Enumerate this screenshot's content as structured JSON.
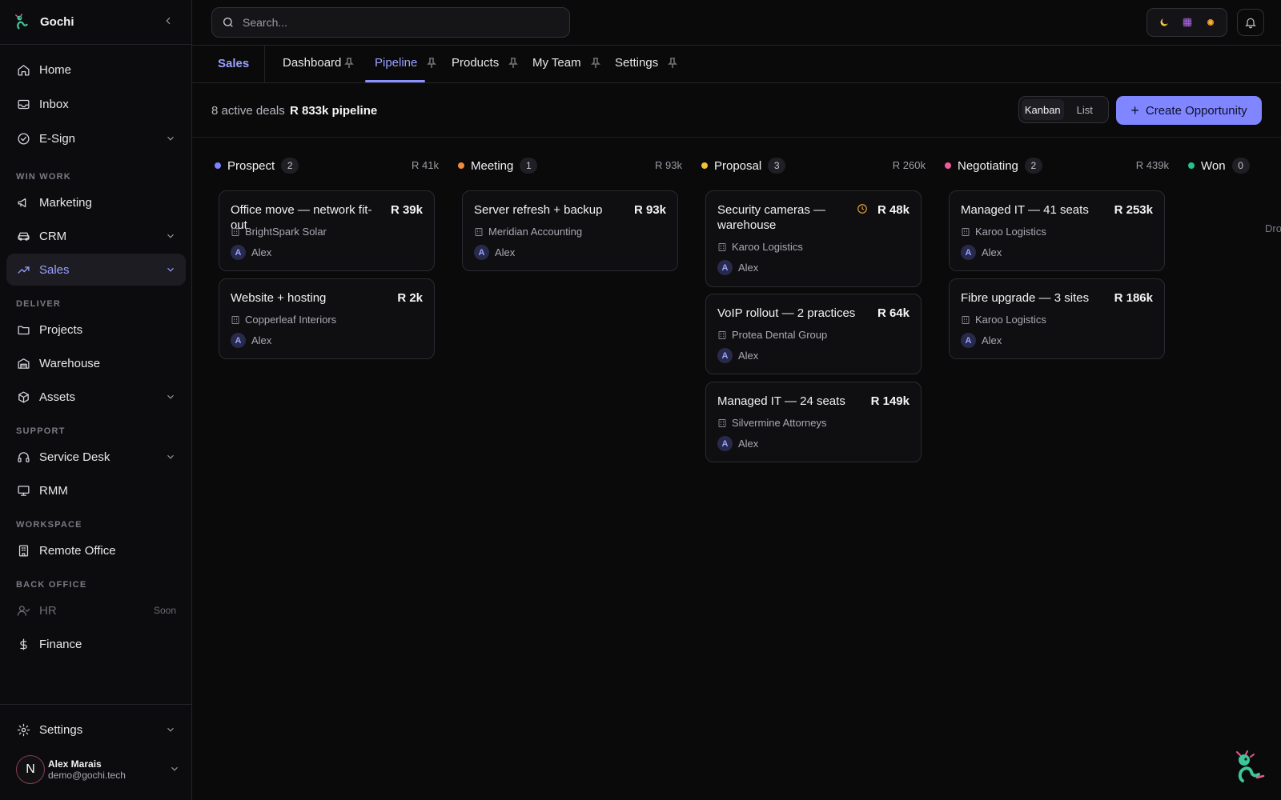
{
  "app": {
    "name": "Gochi"
  },
  "sidebar": {
    "items": [
      {
        "label": "Home",
        "icon": "home-icon"
      },
      {
        "label": "Inbox",
        "icon": "inbox-icon"
      },
      {
        "label": "E-Sign",
        "icon": "check-circle-icon"
      },
      {
        "label": "Marketing",
        "icon": "megaphone-icon"
      },
      {
        "label": "CRM",
        "icon": "car-icon"
      },
      {
        "label": "Sales",
        "icon": "trending-up-icon"
      },
      {
        "label": "Projects",
        "icon": "folder-icon"
      },
      {
        "label": "Warehouse",
        "icon": "warehouse-icon"
      },
      {
        "label": "Assets",
        "icon": "box-icon"
      },
      {
        "label": "Service Desk",
        "icon": "headset-icon"
      },
      {
        "label": "RMM",
        "icon": "monitor-icon"
      },
      {
        "label": "Remote Office",
        "icon": "building-icon"
      },
      {
        "label": "HR",
        "icon": "user-check-icon"
      },
      {
        "label": "Finance",
        "icon": "dollar-icon"
      }
    ],
    "sections": [
      "WIN WORK",
      "DELIVER",
      "SUPPORT",
      "WORKSPACE",
      "BACK OFFICE"
    ],
    "soon_label": "Soon",
    "settings_label": "Settings",
    "user": {
      "initial": "N",
      "name": "Alex Marais",
      "email": "demo@gochi.tech"
    }
  },
  "search": {
    "placeholder": "Search..."
  },
  "tabs": {
    "module": "Sales",
    "items": [
      "Dashboard",
      "Pipeline",
      "Products",
      "My Team",
      "Settings"
    ],
    "active": "Pipeline"
  },
  "summary": {
    "active_deals": "8 active deals",
    "pipeline_total": "R 833k pipeline",
    "view_kanban": "Kanban",
    "view_list": "List",
    "create_label": "Create Opportunity"
  },
  "colors": {
    "accent": "#8b92ff",
    "prospect": "#7b83ff",
    "meeting": "#f08a3c",
    "proposal": "#f2c230",
    "negotiating": "#ee5a9a",
    "won": "#27c28a"
  },
  "columns": [
    {
      "name": "Prospect",
      "count": "2",
      "total": "R 41k",
      "cards": [
        {
          "title": "Office move — network fit-out",
          "amount": "R 39k",
          "company": "BrightSpark Solar",
          "owner": "Alex",
          "initial": "A"
        },
        {
          "title": "Website + hosting",
          "amount": "R 2k",
          "company": "Copperleaf Interiors",
          "owner": "Alex",
          "initial": "A"
        }
      ]
    },
    {
      "name": "Meeting",
      "count": "1",
      "total": "R 93k",
      "cards": [
        {
          "title": "Server refresh + backup",
          "amount": "R 93k",
          "company": "Meridian Accounting",
          "owner": "Alex",
          "initial": "A"
        }
      ]
    },
    {
      "name": "Proposal",
      "count": "3",
      "total": "R 260k",
      "cards": [
        {
          "title": "Security cameras — warehouse",
          "amount": "R 48k",
          "company": "Karoo Logistics",
          "owner": "Alex",
          "initial": "A"
        },
        {
          "title": "VoIP rollout — 2 practices",
          "amount": "R 64k",
          "company": "Protea Dental Group",
          "owner": "Alex",
          "initial": "A"
        },
        {
          "title": "Managed IT — 24 seats",
          "amount": "R 149k",
          "company": "Silvermine Attorneys",
          "owner": "Alex",
          "initial": "A"
        }
      ]
    },
    {
      "name": "Negotiating",
      "count": "2",
      "total": "R 439k",
      "cards": [
        {
          "title": "Managed IT — 41 seats",
          "amount": "R 253k",
          "company": "Karoo Logistics",
          "owner": "Alex",
          "initial": "A"
        },
        {
          "title": "Fibre upgrade — 3 sites",
          "amount": "R 186k",
          "company": "Karoo Logistics",
          "owner": "Alex",
          "initial": "A"
        }
      ]
    },
    {
      "name": "Won",
      "count": "0",
      "drop_hint": "Dro"
    }
  ]
}
